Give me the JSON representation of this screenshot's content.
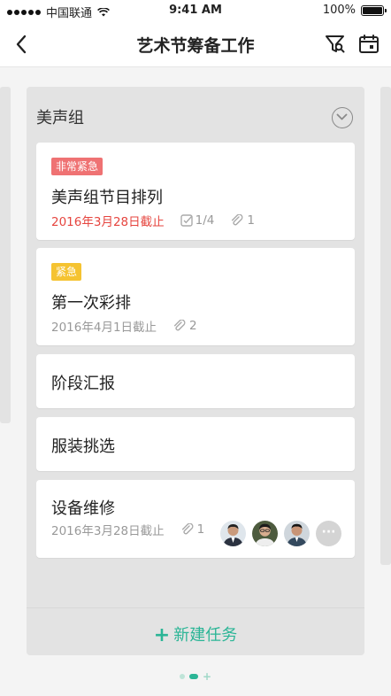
{
  "status_bar": {
    "carrier": "中国联通",
    "time": "9:41 AM",
    "battery": "100%"
  },
  "nav": {
    "title": "艺术节筹备工作"
  },
  "column": {
    "title": "美声组",
    "add_task_label": "新建任务",
    "cards": [
      {
        "tag": "非常紧急",
        "tag_color": "#ef7273",
        "title": "美声组节目排列",
        "due": "2016年3月28日截止",
        "due_color": "#e6453f",
        "checklist": "1/4",
        "attachments": "1"
      },
      {
        "tag": "紧急",
        "tag_color": "#f5c331",
        "title": "第一次彩排",
        "due": "2016年4月1日截止",
        "attachments": "2"
      },
      {
        "title": "阶段汇报"
      },
      {
        "title": "服装挑选"
      },
      {
        "title": "设备维修",
        "due": "2016年3月28日截止",
        "attachments": "1",
        "more_members": "···"
      }
    ]
  },
  "colors": {
    "accent": "#2bb596",
    "overdue": "#e6453f"
  }
}
